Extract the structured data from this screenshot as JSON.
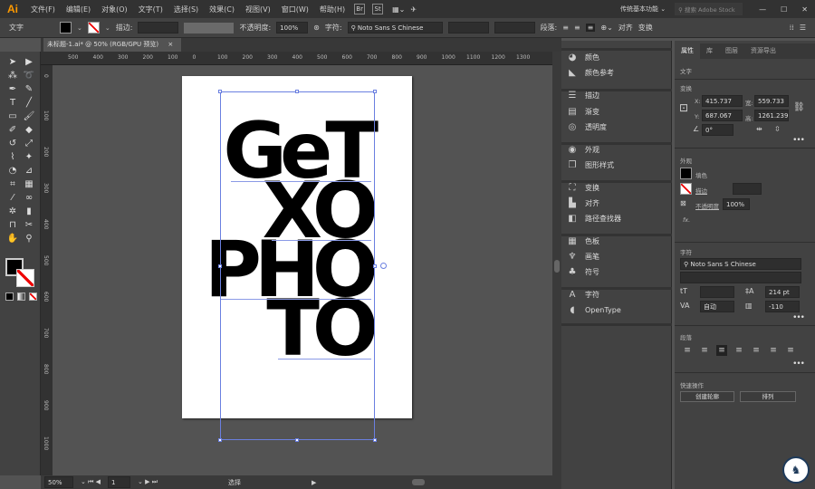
{
  "app": {
    "logo": "Ai",
    "workspace": "传统基本功能",
    "search_placeholder": "搜索 Adobe Stock"
  },
  "menu": [
    "文件(F)",
    "编辑(E)",
    "对象(O)",
    "文字(T)",
    "选择(S)",
    "效果(C)",
    "视图(V)",
    "窗口(W)",
    "帮助(H)"
  ],
  "menu_buttons": [
    "Br",
    "St"
  ],
  "control": {
    "type_label": "文字",
    "stroke_label": "描边:",
    "opacity_label": "不透明度:",
    "opacity": "100%",
    "char_label": "字符:",
    "font": "Noto Sans S Chinese",
    "para_label": "段落:",
    "align_label": "对齐",
    "transform_label": "变换"
  },
  "doc_tab": {
    "title": "未标题-1.ai* @ 50% (RGB/GPU 预览)",
    "close": "×"
  },
  "rulers": {
    "h": [
      "500",
      "400",
      "300",
      "200",
      "100",
      "0",
      "100",
      "200",
      "300",
      "400",
      "500",
      "600",
      "700",
      "800",
      "900",
      "1000",
      "1100",
      "1200",
      "1300"
    ],
    "v": [
      "0",
      "100",
      "200",
      "300",
      "400",
      "500",
      "600",
      "700",
      "800",
      "900",
      "1000"
    ]
  },
  "canvas_text": [
    "GeT",
    "XO",
    "PHO",
    "TO"
  ],
  "status": {
    "zoom": "50%",
    "page": "1",
    "tool": "选择"
  },
  "mid_panel": [
    {
      "icon": "color-icon",
      "glyph": "◕",
      "label": "颜色"
    },
    {
      "icon": "color-guide-icon",
      "glyph": "◣",
      "label": "颜色参考"
    },
    {
      "icon": "stroke-icon",
      "glyph": "☰",
      "label": "描边"
    },
    {
      "icon": "gradient-icon",
      "glyph": "▤",
      "label": "渐变"
    },
    {
      "icon": "transparency-icon",
      "glyph": "◎",
      "label": "透明度"
    },
    {
      "icon": "appearance-icon",
      "glyph": "◉",
      "label": "外观"
    },
    {
      "icon": "graphic-styles-icon",
      "glyph": "❐",
      "label": "图形样式"
    },
    {
      "icon": "transform-icon",
      "glyph": "⛶",
      "label": "变换"
    },
    {
      "icon": "align-icon",
      "glyph": "▙",
      "label": "对齐"
    },
    {
      "icon": "pathfinder-icon",
      "glyph": "◧",
      "label": "路径查找器"
    },
    {
      "icon": "swatches-icon",
      "glyph": "▦",
      "label": "色板"
    },
    {
      "icon": "brushes-icon",
      "glyph": "♆",
      "label": "画笔"
    },
    {
      "icon": "symbols-icon",
      "glyph": "♣",
      "label": "符号"
    },
    {
      "icon": "character-icon",
      "glyph": "A",
      "label": "字符"
    },
    {
      "icon": "opentype-icon",
      "glyph": "◖",
      "label": "OpenType"
    }
  ],
  "properties": {
    "tabs": [
      "属性",
      "库",
      "图层",
      "资源导出"
    ],
    "type_section": "文字",
    "transform": {
      "title": "变换",
      "x_label": "X:",
      "x": "415.737",
      "y_label": "Y:",
      "y": "687.067",
      "w_label": "宽:",
      "w": "559.733",
      "h_label": "高:",
      "h": "1261.239",
      "angle": "0°"
    },
    "appearance": {
      "title": "外观",
      "fill_label": "填色",
      "stroke_label": "描边",
      "opacity_label": "不透明度",
      "opacity": "100%",
      "fx": "fx."
    },
    "character": {
      "title": "字符",
      "font": "Noto Sans S Chinese",
      "leading": "214 pt",
      "kerning": "自动",
      "tracking": "-110"
    },
    "paragraph": {
      "title": "段落"
    },
    "quick_actions": {
      "title": "快速操作",
      "create_outlines": "创建轮廓",
      "arrange": "排列"
    }
  },
  "colors": {
    "accent": "#6a7fe0",
    "logo": "#ff9a00",
    "fill": "#000000"
  }
}
